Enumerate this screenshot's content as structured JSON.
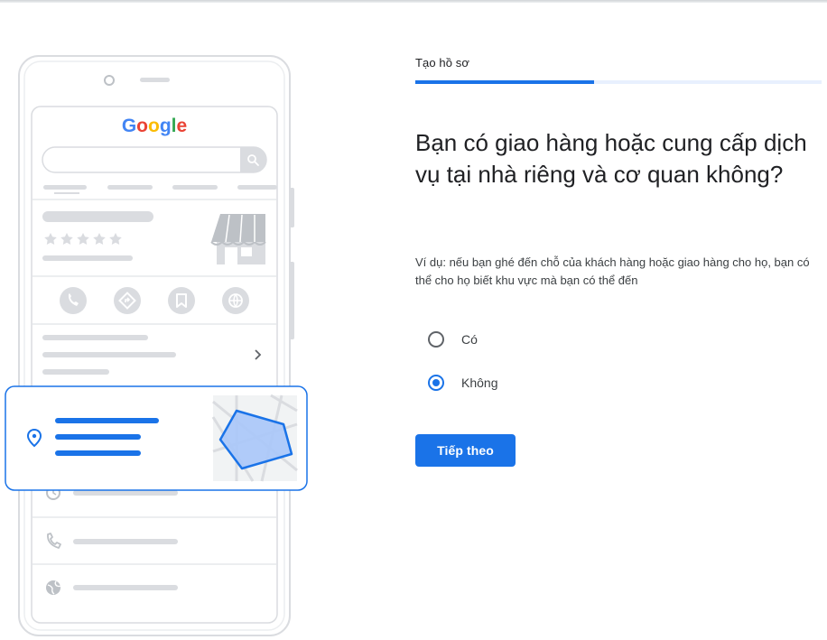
{
  "illustration": {
    "google_logo_text": "Google",
    "google_logo_letters": [
      {
        "char": "G",
        "color": "#4285F4"
      },
      {
        "char": "o",
        "color": "#EA4335"
      },
      {
        "char": "o",
        "color": "#FBBC05"
      },
      {
        "char": "g",
        "color": "#4285F4"
      },
      {
        "char": "l",
        "color": "#34A853"
      },
      {
        "char": "e",
        "color": "#EA4335"
      }
    ],
    "colors": {
      "accent": "#1a73e8",
      "placeholder_gray": "#dadce0",
      "outline_gray": "#dadce0",
      "area_fill": "#a8c7fa"
    }
  },
  "header": {
    "step_label": "Tạo hồ sơ",
    "progress": 0.44
  },
  "main": {
    "question": "Bạn có giao hàng hoặc cung cấp dịch vụ tại nhà riêng và cơ quan không?",
    "hint": "Ví dụ: nếu bạn ghé đến chỗ của khách hàng hoặc giao hàng cho họ, bạn có thể cho họ biết khu vực mà bạn có thể đến",
    "options": [
      {
        "label": "Có",
        "selected": false
      },
      {
        "label": "Không",
        "selected": true
      }
    ],
    "next_button": "Tiếp theo"
  }
}
